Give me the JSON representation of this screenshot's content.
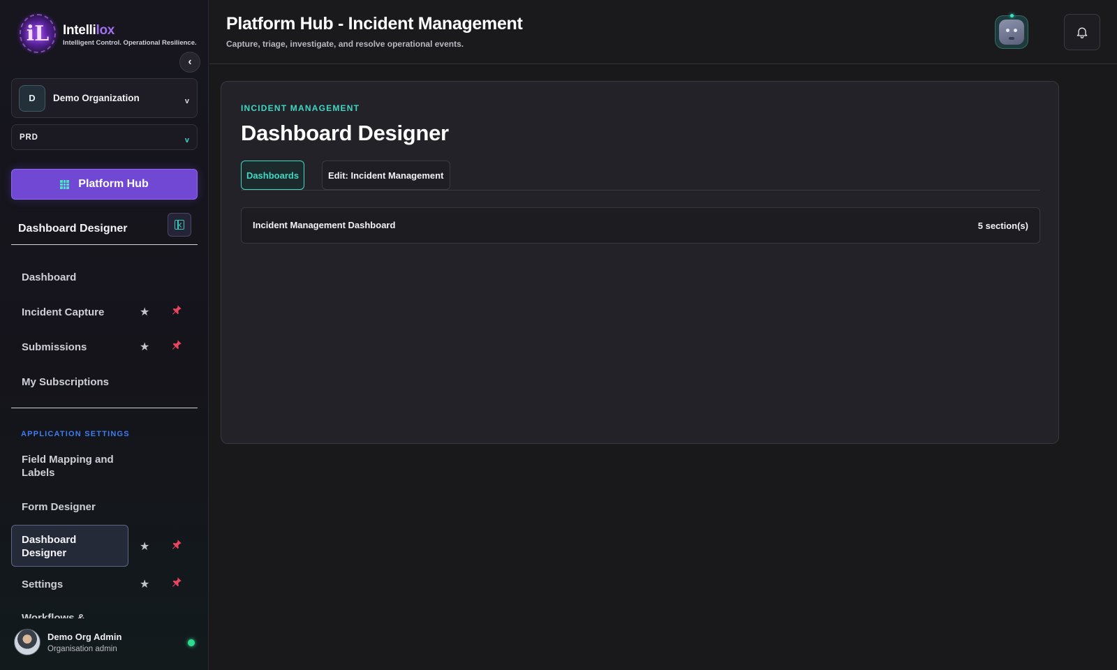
{
  "brand": {
    "name_main": "Intelli",
    "name_accent": "lox",
    "tagline": "Intelligent Control. Operational Resilience.",
    "logo_glyph": "iL"
  },
  "sidebar": {
    "collapse_glyph": "‹",
    "org": {
      "initial": "D",
      "name": "Demo Organization",
      "chevron": "v"
    },
    "environment": {
      "label": "PRD",
      "chevron": "v"
    },
    "hub_button_label": "Platform Hub",
    "section_title": "Dashboard Designer",
    "items": [
      {
        "label": "Dashboard",
        "star": false,
        "pin": false
      },
      {
        "label": "Incident Capture",
        "star": true,
        "pin": true
      },
      {
        "label": "Submissions",
        "star": true,
        "pin": true
      },
      {
        "label": "My Subscriptions",
        "star": false,
        "pin": false
      }
    ],
    "group_label": "APPLICATION SETTINGS",
    "settings_items": [
      {
        "label": "Field Mapping and Labels",
        "star": false,
        "pin": false
      },
      {
        "label": "Form Designer",
        "star": false,
        "pin": false
      },
      {
        "label": "Dashboard Designer",
        "star": true,
        "pin": true,
        "active": true
      },
      {
        "label": "Settings",
        "star": true,
        "pin": true
      },
      {
        "label": "Workflows &",
        "star": false,
        "pin": false
      }
    ],
    "star_glyph": "★",
    "user": {
      "name": "Demo Org Admin",
      "role": "Organisation admin",
      "status_color": "#2ddc8e"
    }
  },
  "header": {
    "title": "Platform Hub - Incident Management",
    "subtitle": "Capture, triage, investigate, and resolve operational events."
  },
  "main": {
    "eyebrow": "INCIDENT MANAGEMENT",
    "title": "Dashboard Designer",
    "tabs": [
      {
        "label": "Dashboards",
        "active": true
      },
      {
        "label": "Edit: Incident Management",
        "active": false
      }
    ],
    "dashboards": [
      {
        "name": "Incident Management Dashboard",
        "sections": "5 section(s)"
      }
    ]
  },
  "colors": {
    "accent_teal": "#3fd8c4",
    "accent_purple": "#7148d4",
    "pin_red": "#e8455f",
    "group_blue": "#3d7df0"
  }
}
